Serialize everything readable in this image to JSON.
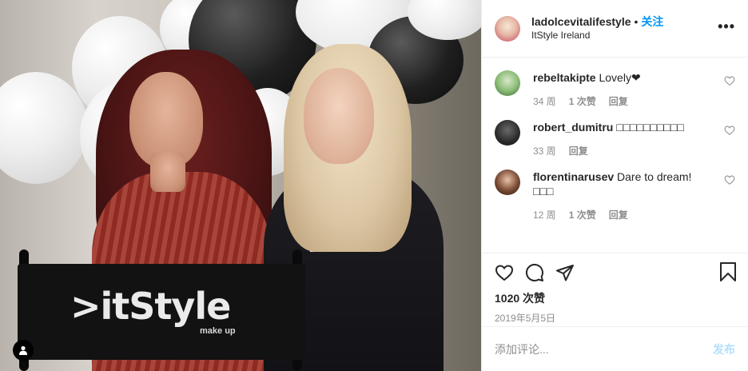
{
  "post": {
    "image_alt": "Two women posing behind a director's chair with balloons",
    "chair_logo": ">itStyle",
    "chair_sub": "make up"
  },
  "header": {
    "username": "ladolcevitalifestyle",
    "separator": "•",
    "follow_label": "关注",
    "location": "ItStyle Ireland",
    "more_label": "•••"
  },
  "comments": [
    {
      "username": "rebeltakipte",
      "text": "Lovely❤",
      "age": "34 周",
      "likes": "1 次赞",
      "reply": "回复"
    },
    {
      "username": "robert_dumitru",
      "text": "□□□□□□□□□□",
      "age": "33 周",
      "likes": "",
      "reply": "回复"
    },
    {
      "username": "florentinarusev",
      "text": "Dare to dream!",
      "text2": "□□□",
      "age": "12 周",
      "likes": "1 次赞",
      "reply": "回复"
    }
  ],
  "stats": {
    "likes_count": "1020 次赞",
    "date": "2019年5月5日"
  },
  "add_comment": {
    "placeholder": "添加评论...",
    "post_label": "发布"
  },
  "colors": {
    "follow": "#0095f6",
    "post_disabled": "#b2dffc",
    "muted": "#8e8e8e"
  }
}
